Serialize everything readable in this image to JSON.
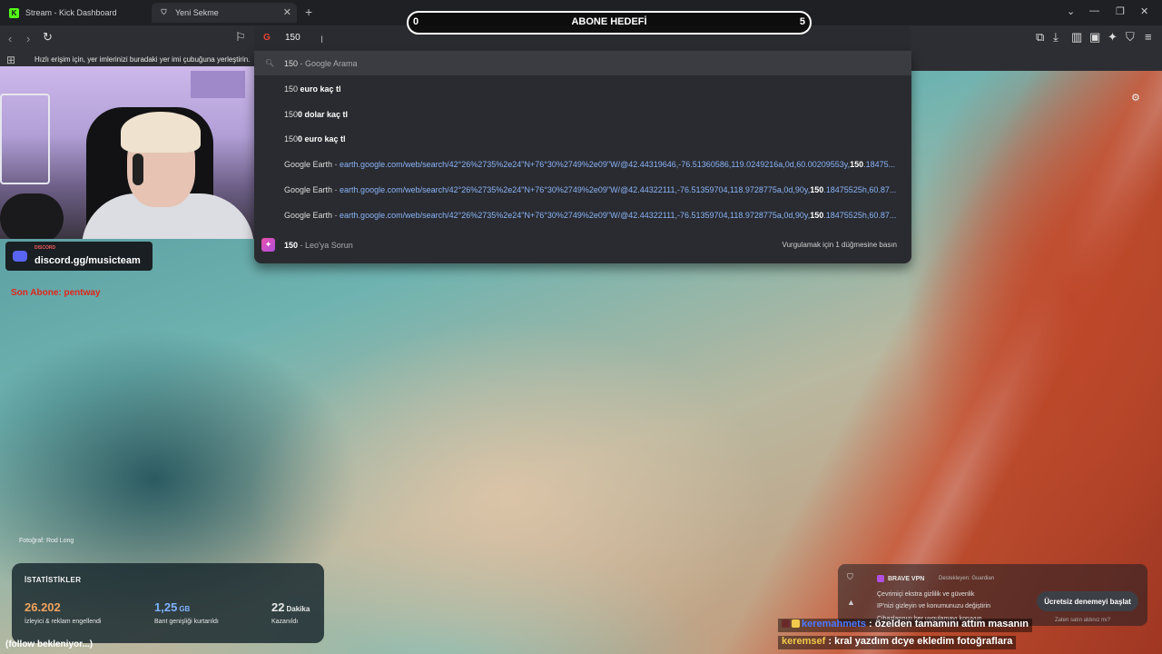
{
  "browser": {
    "tabs": [
      {
        "label": "Stream - Kick Dashboard",
        "icon": "kick-logo-icon",
        "active": false
      },
      {
        "label": "Yeni Sekme",
        "icon": "brave-shield-icon",
        "active": true
      }
    ],
    "address_text": "150",
    "bookmarks_hint": "Hızlı erişim için, yer imlerinizi buradaki yer imi çubuğuna yerleştirin.",
    "suggestions": [
      {
        "type": "search",
        "prefix": "150",
        "suffix": " - Google Arama"
      },
      {
        "type": "query",
        "prefix": "150",
        "bold": " euro kaç tl"
      },
      {
        "type": "query",
        "prefix": "150",
        "bold": "0 dolar kaç tl"
      },
      {
        "type": "query",
        "prefix": "150",
        "bold": "0 euro kaç tl"
      },
      {
        "type": "history",
        "title": "Google Earth",
        "sep": " - ",
        "url_before": "earth.google.com/web/search/42°26%2735%2e24\"N+76°30%2749%2e09\"W/@42.44319646,-76.51360586,119.0249216a,0d,60.00209553y,",
        "url_bold": "150",
        "url_after": ".18475..."
      },
      {
        "type": "history",
        "title": "Google Earth",
        "sep": " - ",
        "url_before": "earth.google.com/web/search/42°26%2735%2e24\"N+76°30%2749%2e09\"W/@42.44322111,-76.51359704,118.9728775a,0d,90y,",
        "url_bold": "150",
        "url_after": ".18475525h,60.87..."
      },
      {
        "type": "history",
        "title": "Google Earth",
        "sep": " - ",
        "url_before": "earth.google.com/web/search/42°26%2735%2e24\"N+76°30%2749%2e09\"W/@42.44322111,-76.51359704,118.9728775a,0d,90y,",
        "url_bold": "150",
        "url_after": ".18475525h,60.87..."
      }
    ],
    "leo": {
      "query": "150",
      "label": " - Leo'ya Sorun",
      "hint": "Vurgulamak için 1 düğmesine basın"
    }
  },
  "goal": {
    "start": "0",
    "title": "ABONE HEDEFİ",
    "end": "5"
  },
  "overlay": {
    "discord_small": "DISCORD",
    "discord_link": "discord.gg/musicteam",
    "last_sub": "Son Abone: pentway",
    "photo_credit": "Fotoğraf: Rod Long",
    "follow_status": "(follow bekleniyor...)"
  },
  "stats": {
    "title": "İSTATİSTİKLER",
    "items": [
      {
        "value": "26.202",
        "unit": "",
        "label": "İzleyici & reklam engellendi",
        "color": "#f0a35e"
      },
      {
        "value": "1,25",
        "unit": "GB",
        "label": "Bant genişliği kurtarıldı",
        "color": "#7fb2ff"
      },
      {
        "value": "22",
        "unit": "Dakika",
        "label": "Kazanıldı",
        "color": "#ffffff"
      }
    ]
  },
  "vpn": {
    "brand": "BRAVE VPN",
    "sponsor": "Destekleyen: Guardian",
    "features": [
      "Çevrimiçi ekstra gizlilik ve güvenlik",
      "IP'nizi gizleyin ve konumunuzu değiştirin",
      "Cihazlarınızı her uygulamayı koruyun"
    ],
    "cta": "Ücretsiz denemeyi başlat",
    "already": "Zaten satın aldınız mı?"
  },
  "chat": [
    {
      "user": "keremahmets",
      "message": " : özelden tamamını attım masanın",
      "user_color": "#4a78ff"
    },
    {
      "user": "keremsef",
      "message": " : kral yazdım dcye ekledim fotoğraflara",
      "user_color": "#f2c94c"
    }
  ]
}
